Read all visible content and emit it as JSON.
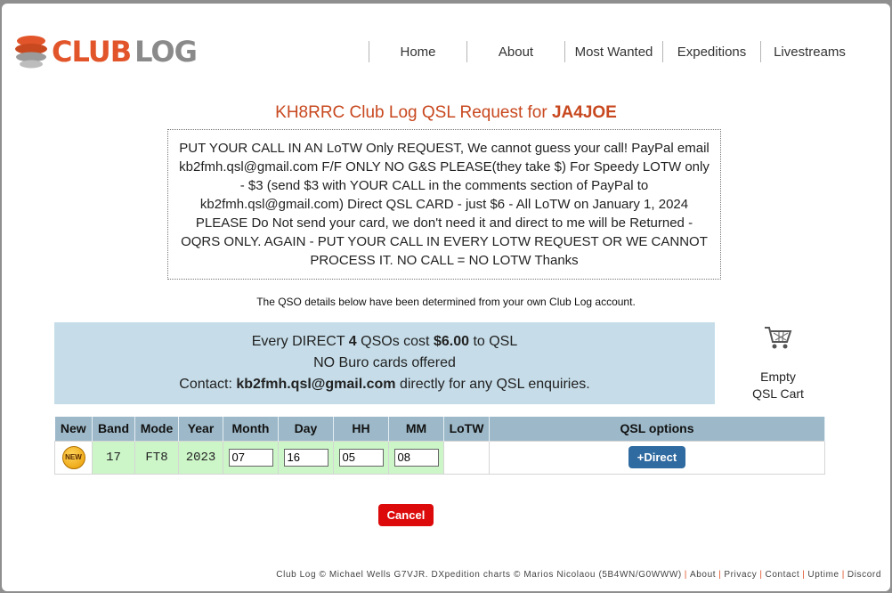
{
  "header": {
    "logo_text_club": "CLUB",
    "logo_text_log": "LOG",
    "nav": [
      "Home",
      "About",
      "Most Wanted",
      "Expeditions",
      "Livestreams"
    ]
  },
  "title": {
    "prefix": "KH8RRC Club Log QSL Request for ",
    "callsign": "JA4JOE"
  },
  "notice": "PUT YOUR CALL IN AN LoTW Only REQUEST, We cannot guess your call! PayPal email kb2fmh.qsl@gmail.com F/F ONLY NO G&S PLEASE(they take $) For Speedy LOTW only - $3 (send $3 with YOUR CALL in the comments section of PayPal to kb2fmh.qsl@gmail.com) Direct QSL CARD - just $6 - All LoTW on January 1, 2024 PLEASE Do Not send your card, we don't need it and direct to me will be Returned - OQRS ONLY. AGAIN - PUT YOUR CALL IN EVERY LOTW REQUEST OR WE CANNOT PROCESS IT. NO CALL = NO LOTW Thanks",
  "qso_note": "The QSO details below have been determined from your own Club Log account.",
  "info": {
    "line1_a": "Every DIRECT ",
    "line1_count": "4",
    "line1_b": " QSOs cost ",
    "line1_price": "$6.00",
    "line1_c": " to QSL",
    "line2": "NO Buro cards offered",
    "line3_a": "Contact: ",
    "line3_email": "kb2fmh.qsl@gmail.com",
    "line3_b": " directly for any QSL enquiries."
  },
  "cart": {
    "line1": "Empty",
    "line2": "QSL Cart",
    "icon": "shopping-cart-icon"
  },
  "table": {
    "headers": [
      "New",
      "Band",
      "Mode",
      "Year",
      "Month",
      "Day",
      "HH",
      "MM",
      "LoTW",
      "QSL options"
    ],
    "row": {
      "new_badge": "NEW",
      "band": "17",
      "mode": "FT8",
      "year": "2023",
      "month": "07",
      "day": "16",
      "hh": "05",
      "mm": "08",
      "lotw": "",
      "direct_button": "+Direct"
    }
  },
  "cancel_button": "Cancel",
  "footer": {
    "credit": "Club Log © Michael Wells G7VJR. DXpedition charts © Marios Nicolaou (5B4WN/G0WWW)",
    "links": [
      "About",
      "Privacy",
      "Contact",
      "Uptime",
      "Discord"
    ]
  },
  "colors": {
    "brand_orange": "#e2552b",
    "info_bg": "#c6dde9",
    "table_header_bg": "#9db9c9",
    "cell_green": "#ccf5c8",
    "direct_button": "#2f6aa0",
    "cancel_button": "#dc0a0a"
  }
}
